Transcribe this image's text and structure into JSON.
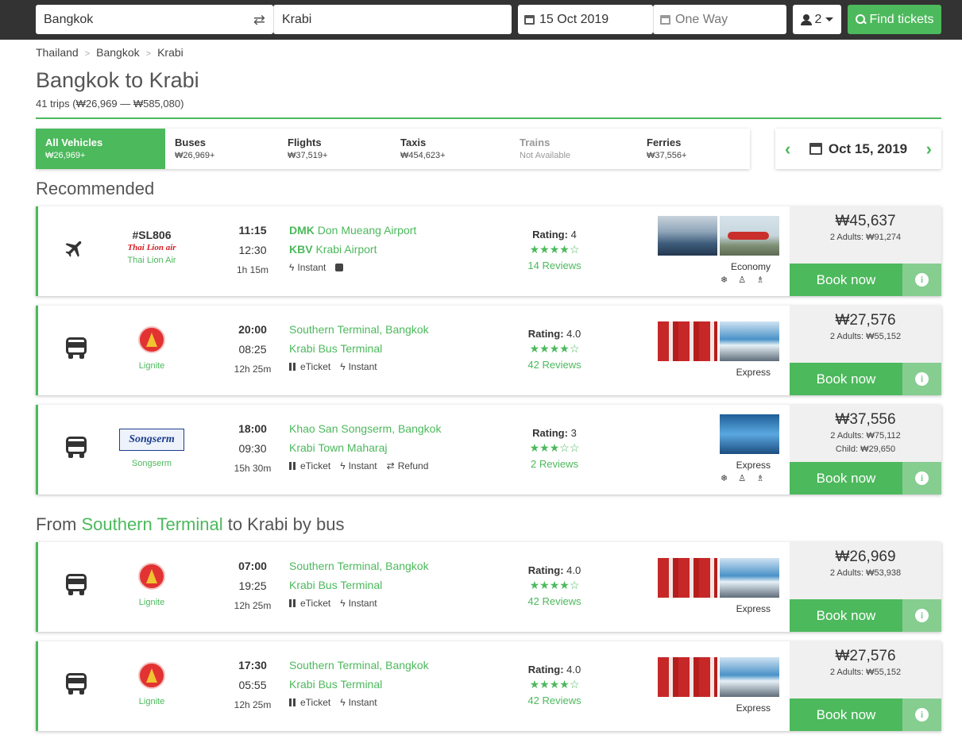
{
  "search": {
    "from": "Bangkok",
    "to": "Krabi",
    "date": "15 Oct 2019",
    "return_placeholder": "One Way",
    "passengers": "2",
    "find_label": "Find tickets"
  },
  "breadcrumb": [
    "Thailand",
    "Bangkok",
    "Krabi"
  ],
  "page": {
    "title": "Bangkok to Krabi",
    "subtitle": "41 trips (₩26,969 — ₩585,080)"
  },
  "tabs": [
    {
      "name": "All Vehicles",
      "price": "₩26,969+"
    },
    {
      "name": "Buses",
      "price": "₩26,969+"
    },
    {
      "name": "Flights",
      "price": "₩37,519+"
    },
    {
      "name": "Taxis",
      "price": "₩454,623+"
    },
    {
      "name": "Trains",
      "price": "Not Available"
    },
    {
      "name": "Ferries",
      "price": "₩37,556+"
    }
  ],
  "date_nav": {
    "date": "Oct 15, 2019"
  },
  "sections": {
    "recommended": "Recommended",
    "from_prefix": "From",
    "from_highlight": "Southern Terminal",
    "from_suffix": "to Krabi by bus"
  },
  "common": {
    "book_label": "Book now",
    "rating_label": "Rating:",
    "info_glyph": "i"
  },
  "trips": [
    {
      "code": "#SL806",
      "logo_text": "Thai Lion air",
      "operator": "Thai Lion Air",
      "dep": "11:15",
      "arr": "12:30",
      "dur": "1h 15m",
      "from_code": "DMK",
      "from": "Don Mueang Airport",
      "to_code": "KBV",
      "to": "Krabi Airport",
      "features": [
        "Instant"
      ],
      "rating": "4",
      "stars": "★★★★☆",
      "reviews": "14 Reviews",
      "class": "Economy",
      "price": "₩45,637",
      "price_detail": "2 Adults: ₩91,274"
    },
    {
      "operator": "Lignite",
      "dep": "20:00",
      "arr": "08:25",
      "dur": "12h 25m",
      "from": "Southern Terminal, Bangkok",
      "to": "Krabi Bus Terminal",
      "features": [
        "eTicket",
        "Instant"
      ],
      "rating": "4.0",
      "stars": "★★★★☆",
      "reviews": "42 Reviews",
      "class": "Express",
      "price": "₩27,576",
      "price_detail": "2 Adults: ₩55,152"
    },
    {
      "logo_text": "Songserm",
      "operator": "Songserm",
      "dep": "18:00",
      "arr": "09:30",
      "dur": "15h 30m",
      "from": "Khao San Songserm, Bangkok",
      "to": "Krabi Town Maharaj",
      "features": [
        "eTicket",
        "Instant",
        "Refund"
      ],
      "rating": "3",
      "stars": "★★★☆☆",
      "reviews": "2 Reviews",
      "class": "Express",
      "price": "₩37,556",
      "price_detail": "2 Adults: ₩75,112",
      "price_child": "Child: ₩29,650"
    },
    {
      "operator": "Lignite",
      "dep": "07:00",
      "arr": "19:25",
      "dur": "12h 25m",
      "from": "Southern Terminal, Bangkok",
      "to": "Krabi Bus Terminal",
      "features": [
        "eTicket",
        "Instant"
      ],
      "rating": "4.0",
      "stars": "★★★★☆",
      "reviews": "42 Reviews",
      "class": "Express",
      "price": "₩26,969",
      "price_detail": "2 Adults: ₩53,938"
    },
    {
      "operator": "Lignite",
      "dep": "17:30",
      "arr": "05:55",
      "dur": "12h 25m",
      "from": "Southern Terminal, Bangkok",
      "to": "Krabi Bus Terminal",
      "features": [
        "eTicket",
        "Instant"
      ],
      "rating": "4.0",
      "stars": "★★★★☆",
      "reviews": "42 Reviews",
      "class": "Express",
      "price": "₩27,576",
      "price_detail": "2 Adults: ₩55,152"
    }
  ],
  "colors": {
    "accent": "#4cb95c",
    "topbar": "#333333",
    "price_bg": "#f0f0f0"
  }
}
